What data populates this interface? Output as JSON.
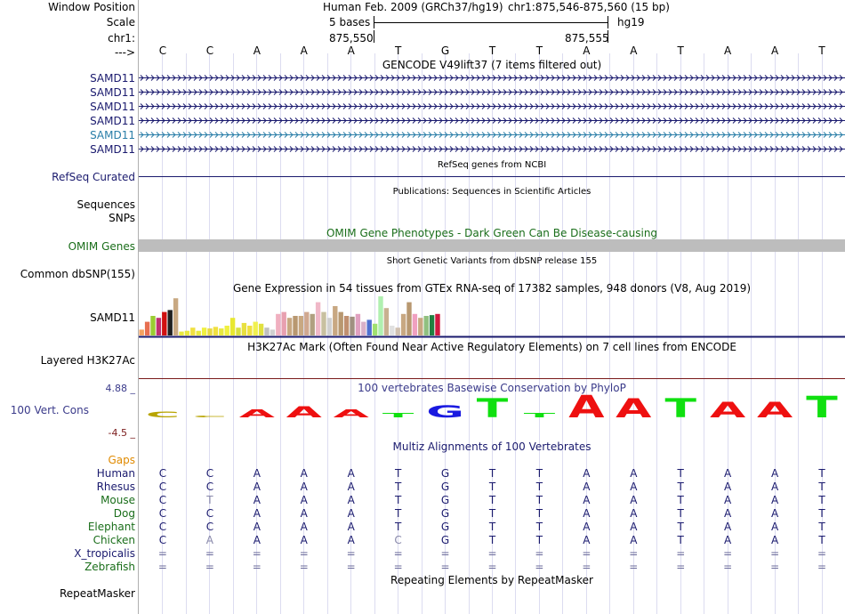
{
  "header": {
    "window_position_label": "Window Position",
    "scale_label": "Scale",
    "chrom_label": "chr1:",
    "arrow_label": "--->",
    "assembly_title": "Human Feb. 2009 (GRCh37/hg19)",
    "position": "chr1:875,546-875,560 (15 bp)",
    "scale_text": "5 bases",
    "scale_db": "hg19",
    "tick_left": "875,550",
    "tick_right": "875,555"
  },
  "bases": [
    "C",
    "C",
    "A",
    "A",
    "A",
    "T",
    "G",
    "T",
    "T",
    "A",
    "A",
    "T",
    "A",
    "A",
    "T"
  ],
  "gencode": {
    "title": "GENCODE V49lift37 (7 items filtered out)",
    "rows": [
      {
        "label": "SAMD11",
        "color": "#1a1a6e"
      },
      {
        "label": "SAMD11",
        "color": "#1a1a6e"
      },
      {
        "label": "SAMD11",
        "color": "#1a1a6e"
      },
      {
        "label": "SAMD11",
        "color": "#1a1a6e"
      },
      {
        "label": "SAMD11",
        "color": "#2a7ea8"
      },
      {
        "label": "SAMD11",
        "color": "#1a1a6e"
      }
    ]
  },
  "refseq": {
    "title": "RefSeq genes from NCBI",
    "label": "RefSeq Curated",
    "color": "#1a1a6e"
  },
  "publications": {
    "title": "Publications: Sequences in Scientific Articles",
    "label_sequences": "Sequences",
    "label_snps": "SNPs"
  },
  "omim": {
    "title": "OMIM Gene Phenotypes - Dark Green Can Be Disease-causing",
    "label": "OMIM Genes",
    "color": "#1a6e1a"
  },
  "dbsnp": {
    "title": "Short Genetic Variants from dbSNP release 155",
    "label": "Common dbSNP(155)"
  },
  "gtex": {
    "title": "Gene Expression in 54 tissues from GTEx RNA-seq of 17382 samples, 948 donors (V8, Aug 2019)",
    "label": "SAMD11",
    "bars": [
      {
        "v": 0.15,
        "c": "#f4a261"
      },
      {
        "v": 0.35,
        "c": "#e76f51"
      },
      {
        "v": 0.5,
        "c": "#9acd32"
      },
      {
        "v": 0.45,
        "c": "#c03070"
      },
      {
        "v": 0.6,
        "c": "#d01010"
      },
      {
        "v": 0.65,
        "c": "#202020"
      },
      {
        "v": 0.95,
        "c": "#c8a882"
      },
      {
        "v": 0.1,
        "c": "#e8e840"
      },
      {
        "v": 0.12,
        "c": "#e8e840"
      },
      {
        "v": 0.2,
        "c": "#f0e040"
      },
      {
        "v": 0.12,
        "c": "#e8e840"
      },
      {
        "v": 0.2,
        "c": "#f0f040"
      },
      {
        "v": 0.18,
        "c": "#e8d840"
      },
      {
        "v": 0.22,
        "c": "#f0e040"
      },
      {
        "v": 0.18,
        "c": "#e8e840"
      },
      {
        "v": 0.25,
        "c": "#f0f040"
      },
      {
        "v": 0.45,
        "c": "#e8e830"
      },
      {
        "v": 0.2,
        "c": "#d8e040"
      },
      {
        "v": 0.32,
        "c": "#e8e040"
      },
      {
        "v": 0.25,
        "c": "#f0e040"
      },
      {
        "v": 0.35,
        "c": "#f0f050"
      },
      {
        "v": 0.3,
        "c": "#e0e040"
      },
      {
        "v": 0.2,
        "c": "#c0c0c0"
      },
      {
        "v": 0.15,
        "c": "#d0d0d0"
      },
      {
        "v": 0.55,
        "c": "#f0b0c0"
      },
      {
        "v": 0.6,
        "c": "#e8a0b0"
      },
      {
        "v": 0.45,
        "c": "#c8a882"
      },
      {
        "v": 0.5,
        "c": "#b89870"
      },
      {
        "v": 0.5,
        "c": "#c8a882"
      },
      {
        "v": 0.6,
        "c": "#d0a890"
      },
      {
        "v": 0.55,
        "c": "#b0a080"
      },
      {
        "v": 0.85,
        "c": "#f0b8c8"
      },
      {
        "v": 0.6,
        "c": "#c8c0a0"
      },
      {
        "v": 0.45,
        "c": "#d0d0d0"
      },
      {
        "v": 0.75,
        "c": "#c8a882"
      },
      {
        "v": 0.6,
        "c": "#b89870"
      },
      {
        "v": 0.5,
        "c": "#c09070"
      },
      {
        "v": 0.48,
        "c": "#a09080"
      },
      {
        "v": 0.55,
        "c": "#e0a0c0"
      },
      {
        "v": 0.35,
        "c": "#d8b0c8"
      },
      {
        "v": 0.4,
        "c": "#5070d0"
      },
      {
        "v": 0.3,
        "c": "#a0e070"
      },
      {
        "v": 1.0,
        "c": "#b0f0b0"
      },
      {
        "v": 0.7,
        "c": "#c8b090"
      },
      {
        "v": 0.25,
        "c": "#e0e0e0"
      },
      {
        "v": 0.2,
        "c": "#d0c0b0"
      },
      {
        "v": 0.55,
        "c": "#c8a882"
      },
      {
        "v": 0.85,
        "c": "#b89870"
      },
      {
        "v": 0.55,
        "c": "#f0a0c0"
      },
      {
        "v": 0.45,
        "c": "#c8a882"
      },
      {
        "v": 0.5,
        "c": "#90c080"
      },
      {
        "v": 0.52,
        "c": "#208040"
      },
      {
        "v": 0.55,
        "c": "#d01840"
      },
      {
        "v": 0.0,
        "c": "#ffffff"
      }
    ]
  },
  "h3k27ac": {
    "title": "H3K27Ac Mark (Often Found Near Active Regulatory Elements) on 7 cell lines from ENCODE",
    "label": "Layered H3K27Ac"
  },
  "cons": {
    "title": "100 vertebrates Basewise Conservation by PhyloP",
    "label": "100 Vert. Cons",
    "ymax": "4.88 _",
    "ymin": "-4.5 _",
    "heights": [
      0.25,
      0.05,
      0.35,
      0.5,
      0.35,
      0.2,
      0.55,
      0.85,
      0.2,
      1.0,
      0.85,
      0.85,
      0.7,
      0.7,
      0.95
    ]
  },
  "multiz": {
    "title": "Multiz Alignments of 100 Vertebrates",
    "gaps_label": "Gaps",
    "species": [
      {
        "name": "Human",
        "color": "#1a1a6e",
        "seq": [
          "C",
          "C",
          "A",
          "A",
          "A",
          "T",
          "G",
          "T",
          "T",
          "A",
          "A",
          "T",
          "A",
          "A",
          "T"
        ]
      },
      {
        "name": "Rhesus",
        "color": "#1a1a6e",
        "seq": [
          "C",
          "C",
          "A",
          "A",
          "A",
          "T",
          "G",
          "T",
          "T",
          "A",
          "A",
          "T",
          "A",
          "A",
          "T"
        ]
      },
      {
        "name": "Mouse",
        "color": "#1a6e1a",
        "seq": [
          "C",
          "T",
          "A",
          "A",
          "A",
          "T",
          "G",
          "T",
          "T",
          "A",
          "A",
          "T",
          "A",
          "A",
          "T"
        ]
      },
      {
        "name": "Dog",
        "color": "#1a6e1a",
        "seq": [
          "C",
          "C",
          "A",
          "A",
          "A",
          "T",
          "G",
          "T",
          "T",
          "A",
          "A",
          "T",
          "A",
          "A",
          "T"
        ]
      },
      {
        "name": "Elephant",
        "color": "#1a6e1a",
        "seq": [
          "C",
          "C",
          "A",
          "A",
          "A",
          "T",
          "G",
          "T",
          "T",
          "A",
          "A",
          "T",
          "A",
          "A",
          "T"
        ]
      },
      {
        "name": "Chicken",
        "color": "#1a6e1a",
        "seq": [
          "C",
          "A",
          "A",
          "A",
          "A",
          "C",
          "G",
          "T",
          "T",
          "A",
          "A",
          "T",
          "A",
          "A",
          "T"
        ]
      },
      {
        "name": "X_tropicalis",
        "color": "#1a1a6e",
        "seq": [
          "=",
          "=",
          "=",
          "=",
          "=",
          "=",
          "=",
          "=",
          "=",
          "=",
          "=",
          "=",
          "=",
          "=",
          "="
        ]
      },
      {
        "name": "Zebrafish",
        "color": "#1a6e1a",
        "seq": [
          "=",
          "=",
          "=",
          "=",
          "=",
          "=",
          "=",
          "=",
          "=",
          "=",
          "=",
          "=",
          "=",
          "=",
          "="
        ]
      }
    ],
    "mismatch": [
      [
        2,
        1
      ],
      [
        5,
        1
      ],
      [
        5,
        5
      ]
    ]
  },
  "repeatmasker": {
    "title": "Repeating Elements by RepeatMasker",
    "label": "RepeatMasker"
  }
}
